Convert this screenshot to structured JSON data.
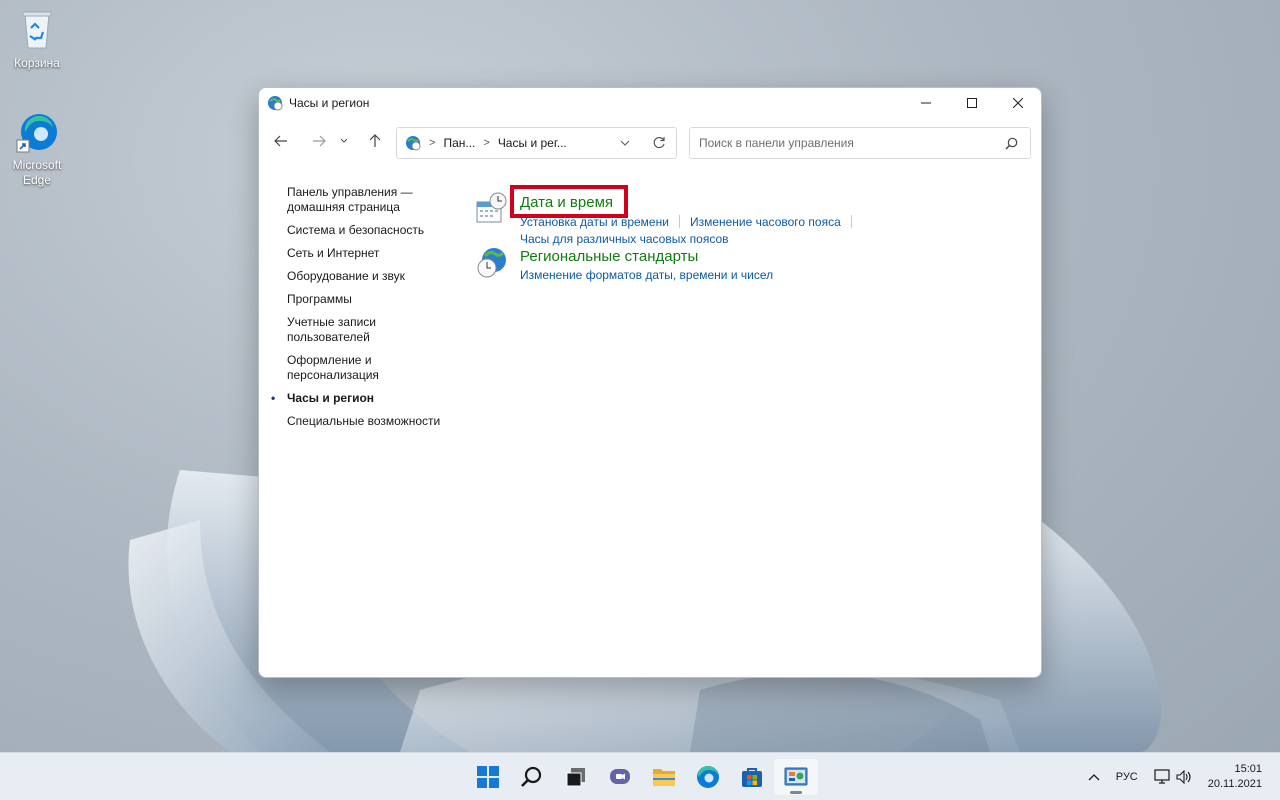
{
  "desktop": {
    "icons": [
      {
        "label": "Корзина",
        "icon": "recycle-bin-icon"
      },
      {
        "label": "Microsoft Edge",
        "icon": "edge-icon"
      }
    ]
  },
  "window": {
    "title": "Часы и регион",
    "controls": {
      "minimize": "minimize-icon",
      "maximize": "maximize-icon",
      "close": "close-icon"
    },
    "address": {
      "crumbs": [
        "Пан...",
        "Часы и рег..."
      ]
    },
    "search": {
      "placeholder": "Поиск в панели управления"
    },
    "sidebar": {
      "items": [
        {
          "label": "Панель управления — домашняя страница"
        },
        {
          "label": "Система и безопасность"
        },
        {
          "label": "Сеть и Интернет"
        },
        {
          "label": "Оборудование и звук"
        },
        {
          "label": "Программы"
        },
        {
          "label": "Учетные записи пользователей"
        },
        {
          "label": "Оформление и персонализация"
        },
        {
          "label": "Часы и регион",
          "active": true
        },
        {
          "label": "Специальные возможности"
        }
      ]
    },
    "categories": [
      {
        "title": "Дата и время",
        "icon": "calendar-clock-icon",
        "links": [
          "Установка даты и времени",
          "Изменение часового пояса",
          "Часы для различных часовых поясов"
        ]
      },
      {
        "title": "Региональные стандарты",
        "icon": "globe-clock-icon",
        "links": [
          "Изменение форматов даты, времени и чисел"
        ]
      }
    ]
  },
  "taskbar": {
    "apps": [
      "start-icon",
      "search-icon",
      "task-view-icon",
      "chat-icon",
      "file-explorer-icon",
      "edge-icon",
      "store-icon",
      "control-panel-icon"
    ],
    "tray": {
      "language": "РУС",
      "time": "15:01",
      "date": "20.11.2021"
    }
  },
  "colors": {
    "link": "#0a5ba8",
    "category_title": "#107c10",
    "highlight": "#d0021b"
  }
}
